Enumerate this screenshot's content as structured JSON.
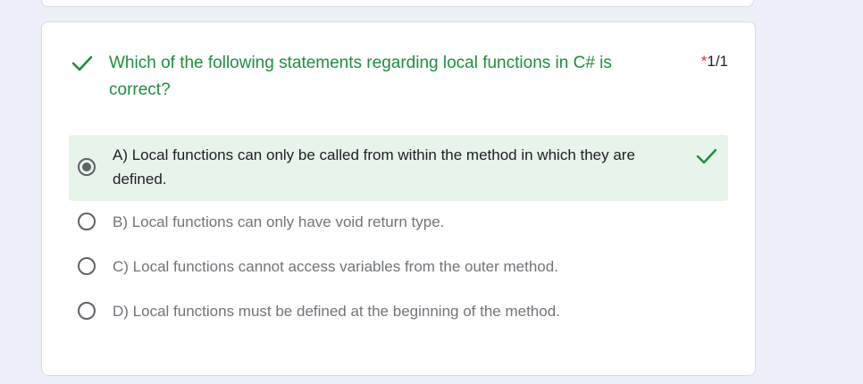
{
  "question": {
    "title": "Which of the following statements regarding local functions in C# is correct?",
    "required_mark": "*",
    "score": "1/1",
    "status": "correct"
  },
  "options": [
    {
      "label": "A) Local functions can only be called from within the method in which they are defined.",
      "selected": true,
      "correct": true
    },
    {
      "label": "B) Local functions can only have void return type.",
      "selected": false,
      "correct": false
    },
    {
      "label": "C) Local functions cannot access variables from the outer method.",
      "selected": false,
      "correct": false
    },
    {
      "label": "D) Local functions must be defined at the beginning of the method.",
      "selected": false,
      "correct": false
    }
  ],
  "icons": {
    "question_status": "check-icon",
    "option_status": "check-icon"
  },
  "colors": {
    "correct_text": "#1e8e3e",
    "correct_bg": "#e6f4ea",
    "required": "#d93025",
    "page_bg": "#edf0f8"
  }
}
